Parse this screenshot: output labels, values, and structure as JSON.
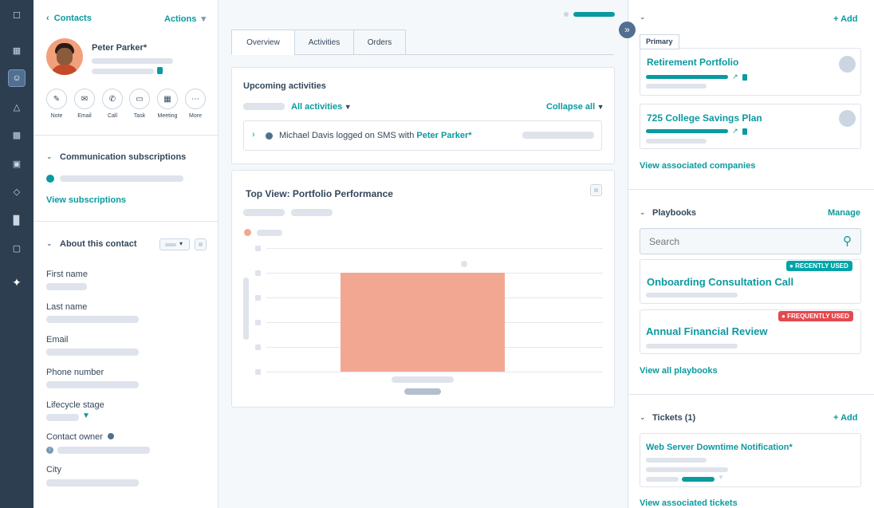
{
  "nav": {
    "icons": [
      "bookmark-icon",
      "grid-icon",
      "contacts-icon",
      "megaphone-icon",
      "calendar-icon",
      "wallet-icon",
      "hierarchy-icon",
      "bar-chart-icon",
      "folder-icon",
      "sparkle-icon"
    ]
  },
  "contact": {
    "back_label": "Contacts",
    "actions_label": "Actions",
    "name": "Peter Parker*"
  },
  "quick_actions": [
    {
      "label": "Note",
      "icon": "note-icon"
    },
    {
      "label": "Email",
      "icon": "email-icon"
    },
    {
      "label": "Call",
      "icon": "call-icon"
    },
    {
      "label": "Task",
      "icon": "task-icon"
    },
    {
      "label": "Meeting",
      "icon": "meeting-icon"
    },
    {
      "label": "More",
      "icon": "more-icon"
    }
  ],
  "communication": {
    "title": "Communication subscriptions",
    "link": "View subscriptions"
  },
  "about": {
    "title": "About this contact",
    "fields": [
      "First name",
      "Last name",
      "Email",
      "Phone number",
      "Lifecycle stage",
      "Contact owner",
      "City"
    ]
  },
  "tabs": [
    "Overview",
    "Activities",
    "Orders"
  ],
  "activities": {
    "title": "Upcoming activities",
    "filter": "All activities",
    "collapse": "Collapse all",
    "item_text": "Michael Davis logged on SMS with",
    "item_link": "Peter Parker*"
  },
  "chart": {
    "title": "Top View: Portfolio Performance"
  },
  "chart_data": {
    "type": "bar",
    "categories": [
      ""
    ],
    "values": [
      1
    ],
    "title": "Top View: Portfolio Performance",
    "xlabel": "",
    "ylabel": "",
    "grid": true,
    "color": "#f2a792"
  },
  "right": {
    "add_label": "+ Add",
    "primary_label": "Primary",
    "company1": "Retirement Portfolio",
    "company2": "725 College Savings Plan",
    "view_companies": "View associated companies",
    "playbooks_title": "Playbooks",
    "manage_label": "Manage",
    "search_placeholder": "Search",
    "playbook1": "Onboarding Consultation Call",
    "playbook1_badge": "RECENTLY USED",
    "playbook2": "Annual Financial Review",
    "playbook2_badge": "FREQUENTLY USED",
    "view_playbooks": "View all playbooks",
    "tickets_title": "Tickets (1)",
    "tickets_add": "+ Add",
    "ticket1": "Web Server Downtime Notification*",
    "view_tickets": "View associated tickets"
  },
  "colors": {
    "accent": "#0a9aa0",
    "nav_bg": "#2d3e50",
    "badge_recent": "#00a4a8",
    "badge_frequent": "#e5484d",
    "bar": "#f2a792"
  }
}
